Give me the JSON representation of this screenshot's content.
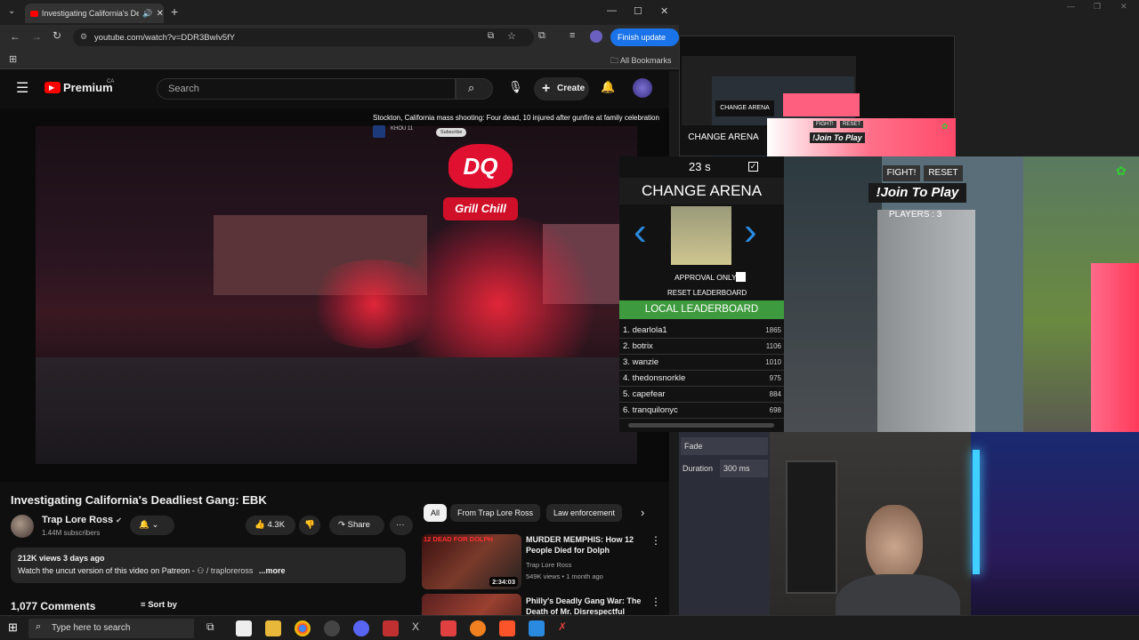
{
  "browser": {
    "tab_title": "Investigating California's De",
    "url": "youtube.com/watch?v=DDR3BwIv5fY",
    "finish_update": "Finish update",
    "all_bookmarks": "All Bookmarks"
  },
  "youtube": {
    "logo_text": "Premium",
    "logo_region": "CA",
    "search_placeholder": "Search",
    "create_label": "Create",
    "video_overlay_title": "Stockton, California mass shooting: Four dead, 10 injured after gunfire at family celebration",
    "video_overlay_channel": "KHOU 11",
    "video_overlay_subscribe": "Subscribe",
    "sign_dq": "DQ",
    "sign_grill": "Grill Chill",
    "video_title": "Investigating California's Deadliest Gang: EBK",
    "channel_name": "Trap Lore Ross",
    "subscribers": "1.44M subscribers",
    "likes": "4.3K",
    "share_label": "Share",
    "views_date": "212K views  3 days ago",
    "description": "Watch the uncut version of this video on Patreon -",
    "patreon_link": "/ traploreross",
    "more_label": "...more",
    "comments_count": "1,077 Comments",
    "sort_by": "Sort by",
    "chips": [
      "All",
      "From Trap Lore Ross",
      "Law enforcement"
    ],
    "recommendations": [
      {
        "title": "MURDER MEMPHIS: How 12 People Died for Dolph",
        "channel": "Trap Lore Ross",
        "meta": "549K views • 1 month ago",
        "duration": "2:34:03",
        "thumb_text": "12 DEAD FOR DOLPH"
      },
      {
        "title": "Philly's Deadly Gang War: The Death of Mr. Disrespectful",
        "channel": "",
        "meta": "",
        "duration": "",
        "thumb_text": ""
      }
    ]
  },
  "game": {
    "timer": "23 s",
    "change_arena": "CHANGE ARENA",
    "approval_only": "APPROVAL ONLY",
    "reset_leaderboard": "RESET LEADERBOARD",
    "local_leaderboard": "LOCAL LEADERBOARD",
    "fight": "FIGHT!",
    "reset": "RESET",
    "join": "!Join To Play",
    "players": "PLAYERS : 3",
    "leaderboard": [
      {
        "rank": "1.",
        "name": "dearlola1",
        "score": "1865"
      },
      {
        "rank": "2.",
        "name": "botrix",
        "score": "1106"
      },
      {
        "rank": "3.",
        "name": "wanzie",
        "score": "1010"
      },
      {
        "rank": "4.",
        "name": "thedonsnorkle",
        "score": "975"
      },
      {
        "rank": "5.",
        "name": "capefear",
        "score": "884"
      },
      {
        "rank": "6.",
        "name": "tranquilonyc",
        "score": "698"
      }
    ],
    "mini_change_arena": "CHANGE ARENA",
    "mini_join": "!Join To Play",
    "mini_fight": "FIGHT!",
    "mini_reset": "RESET"
  },
  "obs": {
    "fade": "Fade",
    "duration_label": "Duration",
    "duration_value": "300 ms"
  },
  "taskbar": {
    "search_placeholder": "Type here to search"
  },
  "colors": {
    "yt_red": "#ff0000",
    "accent_blue": "#1a73e8",
    "leaderboard_green": "#3e9a3e",
    "join_pink": "#ff4f6e"
  }
}
